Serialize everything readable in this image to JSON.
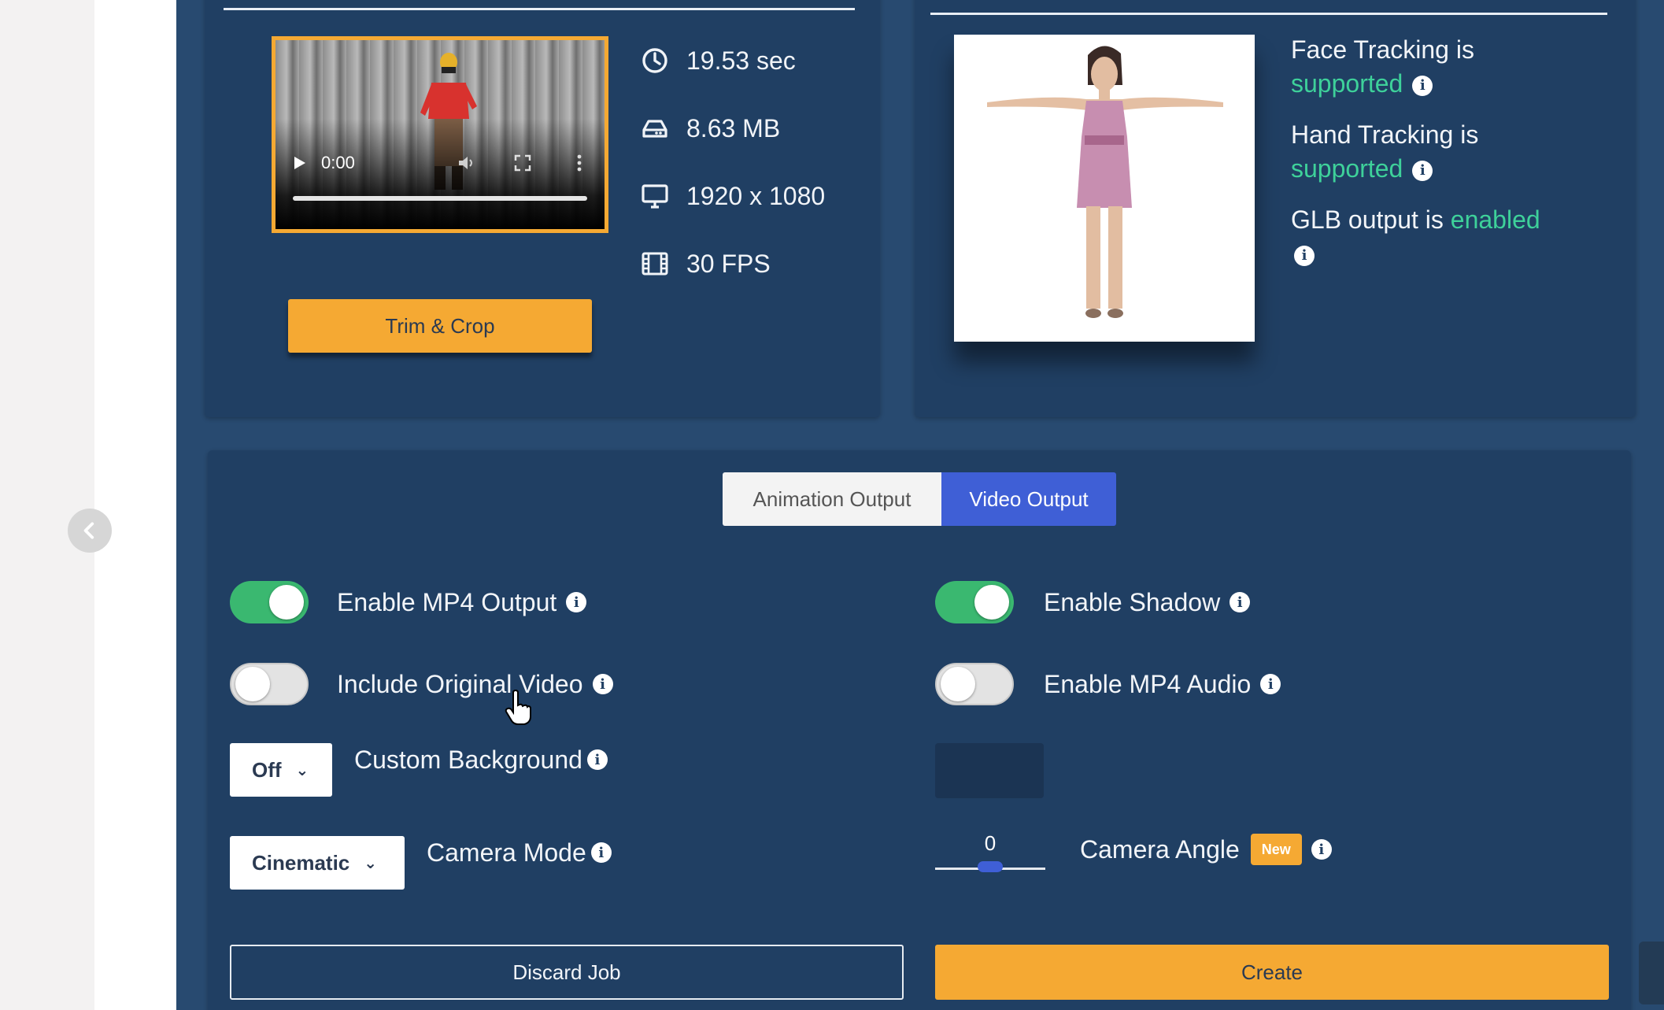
{
  "nav": {
    "back_icon": "chevron-left-icon"
  },
  "video_panel": {
    "player": {
      "time": "0:00",
      "progress": 0.0
    },
    "stats": [
      {
        "icon": "clock-icon",
        "value": "19.53 sec"
      },
      {
        "icon": "hard-drive-icon",
        "value": "8.63 MB"
      },
      {
        "icon": "monitor-icon",
        "value": "1920 x 1080"
      },
      {
        "icon": "film-icon",
        "value": "30 FPS"
      }
    ],
    "trim_button": "Trim & Crop"
  },
  "model_panel": {
    "face": {
      "prefix": "Face Tracking is",
      "status": "supported"
    },
    "hand": {
      "prefix": "Hand Tracking is",
      "status": "supported"
    },
    "glb": {
      "prefix": "GLB output is",
      "status": "enabled"
    }
  },
  "output_panel": {
    "tabs": [
      {
        "label": "Animation Output",
        "active": false
      },
      {
        "label": "Video Output",
        "active": true
      }
    ],
    "options": {
      "mp4_output": {
        "label": "Enable MP4 Output",
        "enabled": true
      },
      "shadow": {
        "label": "Enable Shadow",
        "enabled": true
      },
      "original_video": {
        "label": "Include Original Video",
        "enabled": false
      },
      "mp4_audio": {
        "label": "Enable MP4 Audio",
        "enabled": false
      },
      "custom_background": {
        "label": "Custom Background",
        "value": "Off"
      },
      "camera_mode": {
        "label": "Camera Mode",
        "value": "Cinematic"
      },
      "camera_angle": {
        "label": "Camera Angle",
        "value": "0",
        "badge": "New"
      }
    },
    "discard_button": "Discard Job",
    "create_button": "Create"
  },
  "colors": {
    "background": "#284a70",
    "panel": "#203f63",
    "accent": "#f5a933",
    "tab_active": "#3f5fd6",
    "toggle_on": "#3ab870",
    "status_green": "#3ed19a"
  }
}
